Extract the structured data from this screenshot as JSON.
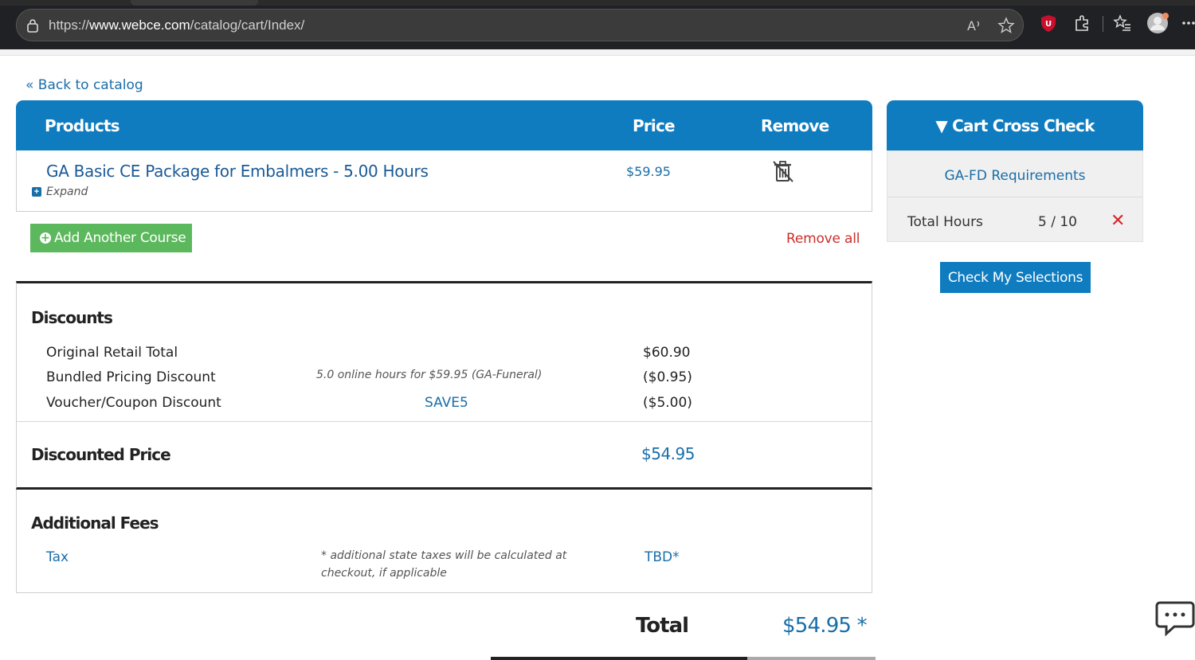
{
  "browser": {
    "url_prefix": "https://",
    "url_host": "www.webce.com",
    "url_path": "/catalog/cart/Index/",
    "icons": [
      "lock-icon",
      "read-aloud-icon",
      "favorite-star-icon",
      "ublock-shield-icon",
      "extensions-puzzle-icon",
      "favorites-list-icon",
      "profile-avatar-icon",
      "more-menu-icon"
    ]
  },
  "page": {
    "back_link": "« Back to catalog"
  },
  "cart": {
    "headers": {
      "products": "Products",
      "price": "Price",
      "remove": "Remove"
    },
    "items": [
      {
        "title": "GA Basic CE Package for Embalmers - 5.00 Hours",
        "expand_label": "Expand",
        "price": "$59.95"
      }
    ],
    "add_course_label": "Add Another Course",
    "remove_all_label": "Remove all"
  },
  "discounts": {
    "title": "Discounts",
    "rows": [
      {
        "label": "Original Retail Total",
        "note": "",
        "value": "$60.90"
      },
      {
        "label": "Bundled Pricing Discount",
        "note": "5.0 online hours for $59.95 (GA-Funeral)",
        "value": "($0.95)"
      },
      {
        "label": "Voucher/Coupon Discount",
        "note": "SAVE5",
        "value": "($5.00)"
      }
    ],
    "discounted_label": "Discounted Price",
    "discounted_value": "$54.95"
  },
  "fees": {
    "title": "Additional Fees",
    "tax_label": "Tax",
    "tax_note": "* additional state taxes will be calculated at checkout, if applicable",
    "tax_value": "TBD*"
  },
  "total": {
    "label": "Total",
    "value": "$54.95 *"
  },
  "cross_check": {
    "title": "▼ Cart Cross Check",
    "requirements_link": "GA-FD Requirements",
    "hours_label": "Total Hours",
    "hours_value": "5 / 10",
    "status_icon": "✕",
    "check_button": "Check My Selections"
  },
  "colors": {
    "header_blue": "#0f7cc0",
    "link_blue": "#1a6ea8",
    "add_green": "#5cb85c",
    "remove_red": "#c9302c"
  }
}
